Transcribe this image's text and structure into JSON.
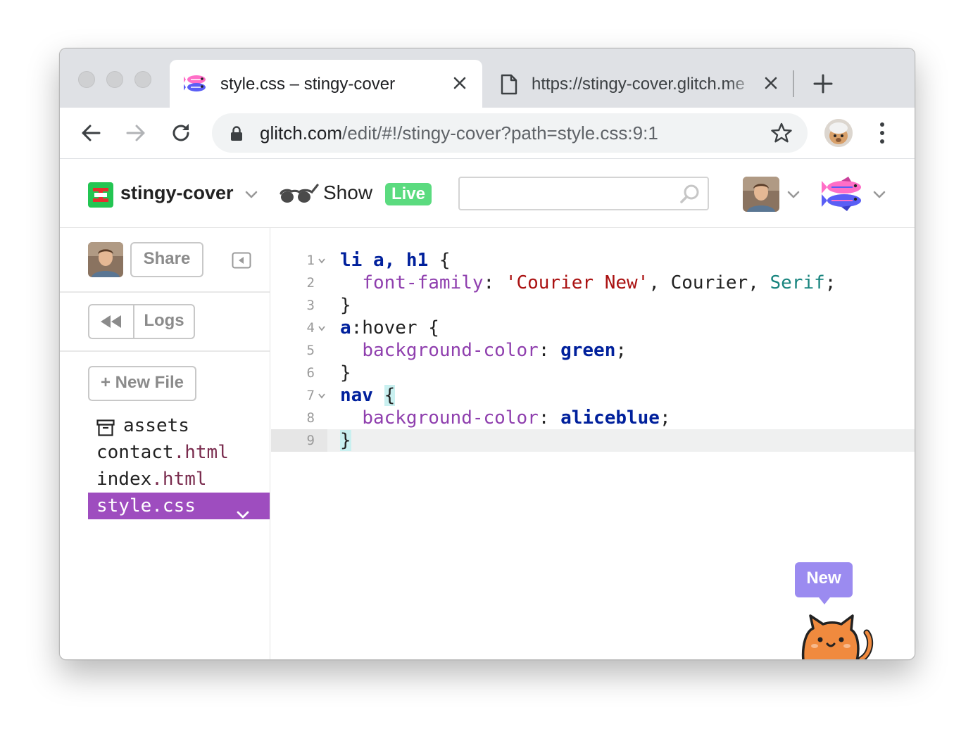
{
  "browser": {
    "tabs": [
      {
        "title": "style.css – stingy-cover",
        "active": true,
        "icon": "glitch-fish-icon"
      },
      {
        "title": "https://stingy-cover.glitch.me",
        "active": false,
        "icon": "page-icon"
      }
    ],
    "address_bar": {
      "host": "glitch.com",
      "path": "/edit/#!/stingy-cover?path=style.css:9:1"
    }
  },
  "glitch_header": {
    "project_name": "stingy-cover",
    "show_label": "Show",
    "live_badge": "Live",
    "search_value": ""
  },
  "sidebar": {
    "share_label": "Share",
    "logs_label": "Logs",
    "new_file_label": "+ New File",
    "files": [
      {
        "name": "assets",
        "ext": "",
        "folder": true,
        "selected": false
      },
      {
        "name": "contact",
        "ext": ".html",
        "folder": false,
        "selected": false
      },
      {
        "name": "index",
        "ext": ".html",
        "folder": false,
        "selected": false
      },
      {
        "name": "style",
        "ext": ".css",
        "folder": false,
        "selected": true
      }
    ]
  },
  "editor": {
    "active_line": 9,
    "lines": [
      {
        "num": "1",
        "fold": true,
        "tokens": [
          {
            "t": "li a, h1",
            "c": "t-sel"
          },
          {
            "t": " {",
            "c": "t-plain"
          }
        ]
      },
      {
        "num": "2",
        "fold": false,
        "tokens": [
          {
            "t": "  ",
            "c": "t-plain"
          },
          {
            "t": "font-family",
            "c": "t-prop"
          },
          {
            "t": ": ",
            "c": "t-plain"
          },
          {
            "t": "'Courier New'",
            "c": "t-str"
          },
          {
            "t": ", Courier, ",
            "c": "t-plain"
          },
          {
            "t": "Serif",
            "c": "t-atom"
          },
          {
            "t": ";",
            "c": "t-plain"
          }
        ]
      },
      {
        "num": "3",
        "fold": false,
        "tokens": [
          {
            "t": "}",
            "c": "t-plain"
          }
        ]
      },
      {
        "num": "4",
        "fold": true,
        "tokens": [
          {
            "t": "a",
            "c": "t-sel"
          },
          {
            "t": ":hover {",
            "c": "t-plain"
          }
        ]
      },
      {
        "num": "5",
        "fold": false,
        "tokens": [
          {
            "t": "  ",
            "c": "t-plain"
          },
          {
            "t": "background-color",
            "c": "t-prop"
          },
          {
            "t": ": ",
            "c": "t-plain"
          },
          {
            "t": "green",
            "c": "t-kw"
          },
          {
            "t": ";",
            "c": "t-plain"
          }
        ]
      },
      {
        "num": "6",
        "fold": false,
        "tokens": [
          {
            "t": "}",
            "c": "t-plain"
          }
        ]
      },
      {
        "num": "7",
        "fold": true,
        "tokens": [
          {
            "t": "nav",
            "c": "t-sel"
          },
          {
            "t": " ",
            "c": "t-plain"
          },
          {
            "t": "{",
            "c": "t-plain t-bracket"
          }
        ]
      },
      {
        "num": "8",
        "fold": false,
        "tokens": [
          {
            "t": "  ",
            "c": "t-plain"
          },
          {
            "t": "background-color",
            "c": "t-prop"
          },
          {
            "t": ": ",
            "c": "t-plain"
          },
          {
            "t": "aliceblue",
            "c": "t-kw"
          },
          {
            "t": ";",
            "c": "t-plain"
          }
        ]
      },
      {
        "num": "9",
        "fold": false,
        "tokens": [
          {
            "t": "}",
            "c": "t-plain t-bracket"
          }
        ]
      }
    ]
  },
  "new_bubble": "New",
  "colors": {
    "selected_file": "#9e4dbf",
    "live_badge": "#5bdb7f",
    "new_bubble": "#9b8bf0",
    "glitch_logo_green": "#23c552",
    "glitch_logo_red": "#e62e2e"
  }
}
